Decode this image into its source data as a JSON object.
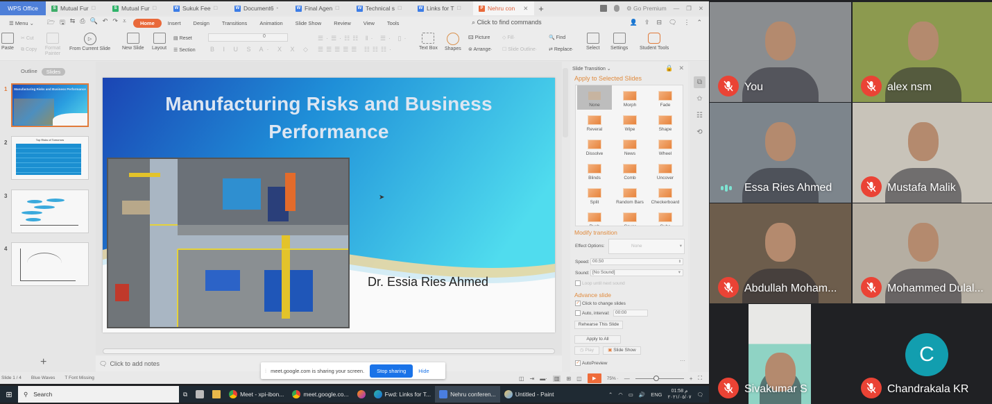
{
  "wps": {
    "app_tab": "WPS Office",
    "tabs": [
      {
        "label": "Mutual Fur",
        "icon": "spreadsheet-icon",
        "color": "#3fae6a"
      },
      {
        "label": "Mutual Fur",
        "icon": "spreadsheet-icon",
        "color": "#2fb36a"
      },
      {
        "label": "Sukuk Fee",
        "icon": "writer-icon",
        "color": "#3c7ce6"
      },
      {
        "label": "Document6",
        "icon": "writer-icon",
        "color": "#3c7ce6"
      },
      {
        "label": "Final Agen",
        "icon": "writer-icon",
        "color": "#3c7ce6"
      },
      {
        "label": "Technical s",
        "icon": "writer-icon",
        "color": "#3c7ce6"
      },
      {
        "label": "Links for T",
        "icon": "writer-icon",
        "color": "#3c7ce6"
      },
      {
        "label": "Nehru con",
        "icon": "presentation-icon",
        "color": "#e9693a",
        "active": true
      }
    ],
    "go_premium": "Go Premium",
    "menu": {
      "menu_label": "Menu",
      "items": [
        "Home",
        "Insert",
        "Design",
        "Transitions",
        "Animation",
        "Slide Show",
        "Review",
        "View",
        "Tools"
      ],
      "find_commands": "Click to find commands"
    },
    "ribbon": {
      "paste": "Paste",
      "cut": "Cut",
      "copy": "Copy",
      "format_painter": "Format Painter",
      "from_current_slide": "From Current Slide",
      "new_slide": "New Slide",
      "layout": "Layout",
      "reset": "Reset",
      "section": "Section",
      "font_size": "0",
      "text_box": "Text Box",
      "shapes": "Shapes",
      "picture": "Picture",
      "fill": "Fill",
      "arrange": "Arrange",
      "slide_outline": "Slide Outline",
      "find": "Find",
      "replace": "Replace",
      "select": "Select",
      "settings": "Settings",
      "student_tools": "Student Tools"
    },
    "outline": {
      "tab_outline": "Outline",
      "tab_slides": "Slides",
      "slides": [
        {
          "num": "1",
          "title": "Manufacturing Risks and Business Performance",
          "selected": true
        },
        {
          "num": "2",
          "title": "Top Risks of Tomorrow"
        },
        {
          "num": "3",
          "title": ""
        },
        {
          "num": "4",
          "title": ""
        }
      ]
    },
    "slide": {
      "title": "Manufacturing Risks and Business Performance",
      "author": "Dr. Essia Ries Ahmed"
    },
    "notes_placeholder": "Click to add notes",
    "transition_panel": {
      "header": "Slide Transition",
      "apply_label": "Apply to Selected Slides",
      "effects": [
        "None",
        "Morph",
        "Fade",
        "Reveral",
        "Wipe",
        "Shape",
        "Dissolve",
        "News",
        "Wheel",
        "Blinds",
        "Comb",
        "Uncover",
        "Split",
        "Random Bars",
        "Checkerboard",
        "Push",
        "Cover",
        "Cube"
      ],
      "selected_effect": "None",
      "modify_label": "Modify transition",
      "effect_options_label": "Effect Options:",
      "effect_options_value": "None",
      "speed_label": "Speed:",
      "speed_value": "00.50",
      "sound_label": "Sound:",
      "sound_value": "[No Sound]",
      "loop_label": "Loop until next sound",
      "advance_label": "Advance slide",
      "click_to_change": "Click to change slides",
      "auto_interval": "Auto, interval:",
      "interval_value": "00:00",
      "rehearse": "Rehearse This Slide",
      "apply_all": "Apply to All",
      "play": "Play",
      "slide_show": "Slide Show",
      "autopreview": "AutoPreview"
    },
    "status": {
      "slide_count": "Slide 1 / 4",
      "theme": "Blue Waves",
      "font_missing": "Font Missing",
      "zoom": "75%"
    }
  },
  "share_banner": {
    "message": "meet.google.com is sharing your screen.",
    "stop": "Stop sharing",
    "hide": "Hide"
  },
  "taskbar": {
    "search": "Search",
    "items": [
      {
        "label": "Meet - xpi-ibon...",
        "icon": "chrome-icon"
      },
      {
        "label": "meet.google.co...",
        "icon": "chrome-icon"
      },
      {
        "label": "",
        "icon": "firefox-icon"
      },
      {
        "label": "Fwd: Links for T...",
        "icon": "edge-icon"
      },
      {
        "label": "Nehru conferen...",
        "icon": "wps-icon",
        "active": true
      },
      {
        "label": "Untitled - Paint",
        "icon": "paint-icon"
      }
    ],
    "language": "ENG",
    "time": "01:58 م",
    "date": "٢٠٢١/٠٥/٠٧"
  },
  "meet": {
    "participants": [
      {
        "name": "You",
        "muted": true,
        "bg": "#8a8d90"
      },
      {
        "name": "alex nsm",
        "muted": true,
        "bg": "#8c9a4f"
      },
      {
        "name": "Essa Ries Ahmed",
        "muted": false,
        "speaking": true,
        "bg": "#7d858c"
      },
      {
        "name": "Mustafa Malik",
        "muted": true,
        "bg": "#c8c3b9"
      },
      {
        "name": "Abdullah Moham...",
        "muted": true,
        "bg": "#6d5d4c"
      },
      {
        "name": "Mohammed Dulal...",
        "muted": true,
        "bg": "#b5aea2"
      },
      {
        "name": "Sivakumar S",
        "muted": true,
        "bg": "#202124"
      },
      {
        "name": "Chandrakala KR",
        "muted": true,
        "avatar_letter": "C",
        "bg": "#202124"
      }
    ]
  }
}
